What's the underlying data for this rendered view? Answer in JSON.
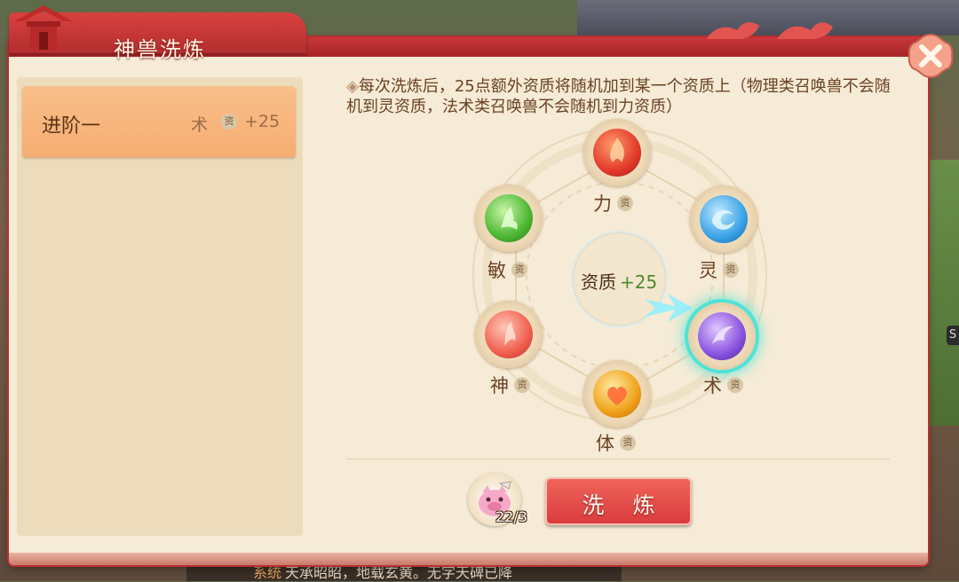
{
  "window": {
    "title": "神兽洗炼"
  },
  "list": {
    "items": [
      {
        "name": "进阶一",
        "attr": "术",
        "badge": "资",
        "value": "+25"
      }
    ]
  },
  "description": "每次洗炼后，25点额外资质将随机加到某一个资质上（物理类召唤兽不会随机到灵资质，法术类召唤兽不会随机到力资质）",
  "wheel": {
    "center_label": "资质",
    "center_value": "+25",
    "badge": "资",
    "nodes": [
      {
        "key": "li",
        "label": "力",
        "icon": "flame-orb-icon",
        "color": "#e23a2a"
      },
      {
        "key": "ling",
        "label": "灵",
        "icon": "swirl-orb-icon",
        "color": "#3aa3e6"
      },
      {
        "key": "shu",
        "label": "术",
        "icon": "magic-orb-icon",
        "color": "#8a52e0",
        "selected": true
      },
      {
        "key": "ti",
        "label": "体",
        "icon": "heart-orb-icon",
        "color": "#f0a21a"
      },
      {
        "key": "shen",
        "label": "神",
        "icon": "spirit-orb-icon",
        "color": "#f0604f"
      },
      {
        "key": "min",
        "label": "敏",
        "icon": "wind-orb-icon",
        "color": "#4cb832"
      }
    ]
  },
  "footer": {
    "item_count": "22/3",
    "refine_label": "洗 炼"
  },
  "chat": {
    "channel": "系统",
    "message": "天承昭昭，地载玄黄。无字天碑已降"
  },
  "side_tag": "S",
  "colors": {
    "accent_red": "#c8363a",
    "panel_bg": "#f6ebd6",
    "selected_item": "#f6ad72",
    "glow": "#4fe3d6"
  }
}
